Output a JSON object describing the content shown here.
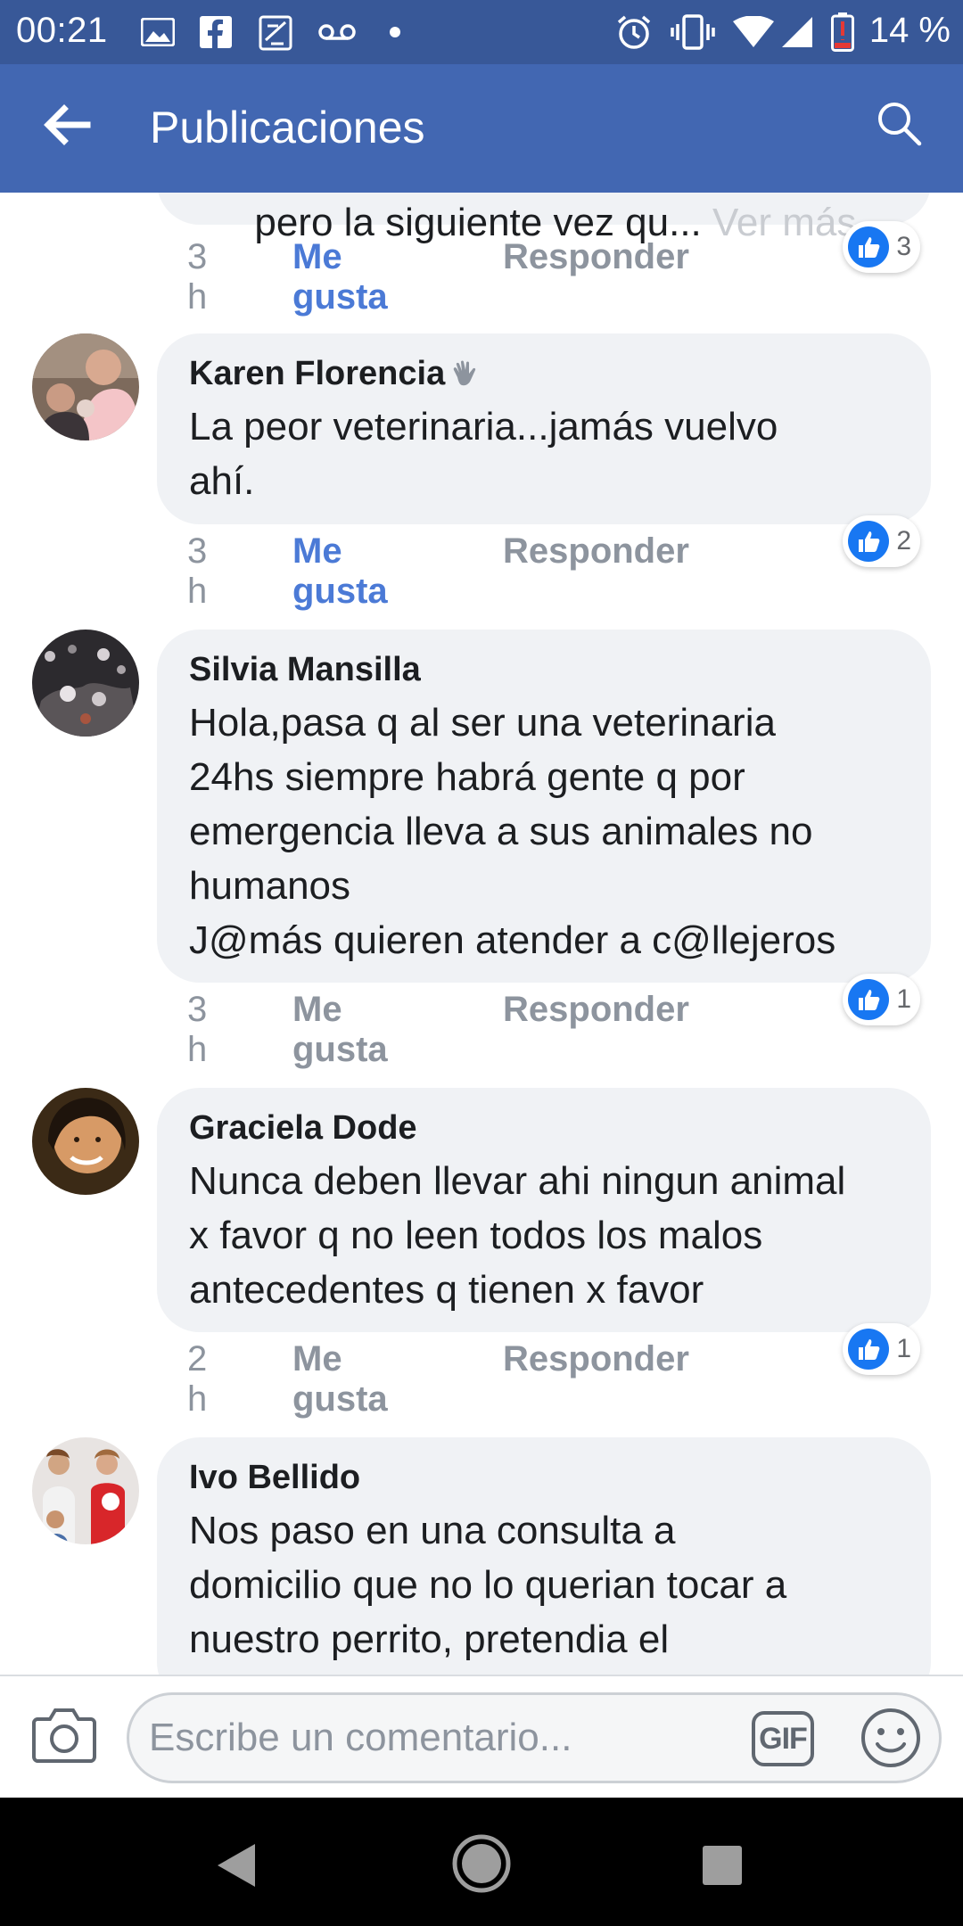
{
  "status_bar": {
    "time": "00:21",
    "battery": "14 %",
    "icons": [
      "gallery-icon",
      "facebook-icon",
      "app-icon",
      "voicemail-icon",
      "dot-icon",
      "alarm-icon",
      "vibrate-icon",
      "wifi-icon",
      "signal-icon",
      "battery-low-icon"
    ]
  },
  "header": {
    "title": "Publicaciones",
    "back_icon": "arrow-left-icon",
    "search_icon": "search-icon"
  },
  "colors": {
    "header_bg": "#4267b2",
    "status_bg": "#385898",
    "like_active": "#4b7ad6",
    "bubble_bg": "#f0f2f5"
  },
  "partial_comment": {
    "text": "pero la siguiente vez qu... ",
    "see_more": "Ver más",
    "time": "3 h",
    "like_label": "Me gusta",
    "reply_label": "Responder",
    "reactions": "3"
  },
  "comments": [
    {
      "author": "Karen Florencia",
      "text": "La peor veterinaria...jamás vuelvo\nahí.",
      "time": "3 h",
      "like_label": "Me gusta",
      "reply_label": "Responder",
      "liked": true,
      "reactions": "2"
    },
    {
      "author": "Silvia Mansilla",
      "text": "Hola,pasa q al ser una veterinaria\n24hs siempre habrá gente q por\nemergencia lleva a sus animales no\nhumanos\nJ@más quieren atender a c@llejeros",
      "time": "3 h",
      "like_label": "Me gusta",
      "reply_label": "Responder",
      "liked": false,
      "reactions": "1"
    },
    {
      "author": "Graciela Dode",
      "text": "Nunca deben llevar ahi ningun animal\nx favor q no leen todos los malos\nantecedentes q tienen x favor",
      "time": "2 h",
      "like_label": "Me gusta",
      "reply_label": "Responder",
      "liked": false,
      "reactions": "1"
    },
    {
      "author": "Ivo Bellido",
      "text": "Nos paso en una consulta a\ndomicilio que no lo querian tocar a\nnuestro perrito, pretendia el",
      "time": "",
      "like_label": "",
      "reply_label": "",
      "liked": false,
      "reactions": ""
    }
  ],
  "composer": {
    "placeholder": "Escribe un comentario...",
    "gif_label": "GIF",
    "camera_icon": "camera-icon",
    "emoji_icon": "emoji-icon"
  },
  "navigation": {
    "back_icon": "nav-back-icon",
    "home_icon": "nav-home-icon",
    "recents_icon": "nav-recents-icon"
  }
}
